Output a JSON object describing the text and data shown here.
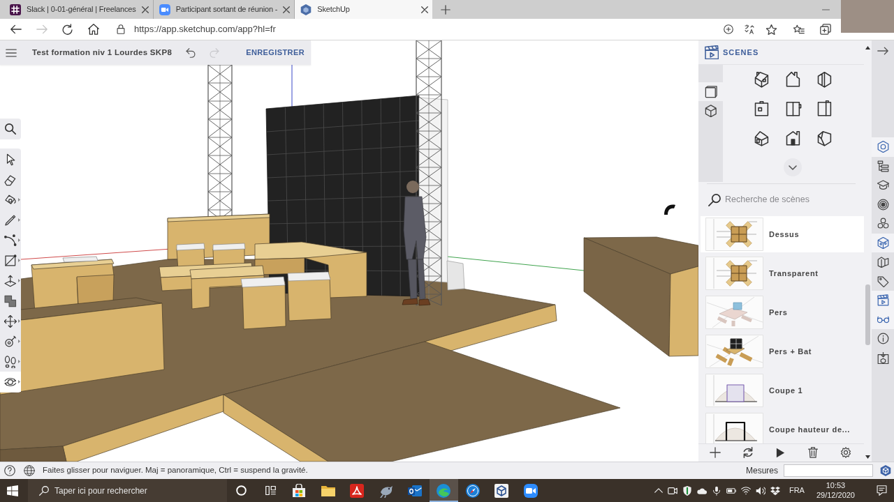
{
  "browser": {
    "tabs": [
      {
        "title": "Slack | 0-01-général | Freelances",
        "selected": false
      },
      {
        "title": "Participant sortant de réunion -",
        "selected": false
      },
      {
        "title": "SketchUp",
        "selected": true
      }
    ],
    "url": "https://app.sketchup.com/app?hl=fr",
    "forward_disabled": true
  },
  "app_header": {
    "title": "Test formation niv 1 Lourdes SKP8",
    "undo_disabled": false,
    "redo_disabled": true,
    "save_label": "ENREGISTRER"
  },
  "tools": [
    {
      "selected": false,
      "submenu": false
    },
    {
      "selected": false,
      "submenu": false
    },
    {
      "selected": false,
      "submenu": true
    },
    {
      "selected": false,
      "submenu": true
    },
    {
      "selected": false,
      "submenu": true
    },
    {
      "selected": false,
      "submenu": true
    },
    {
      "selected": false,
      "submenu": true
    },
    {
      "selected": false,
      "submenu": false
    },
    {
      "selected": false,
      "submenu": true
    },
    {
      "selected": false,
      "submenu": true
    },
    {
      "selected": false,
      "submenu": true
    },
    {
      "selected": true,
      "submenu": true
    }
  ],
  "scenes_panel": {
    "title": "SCENES",
    "view_tabs": [
      {
        "selected": true
      },
      {
        "selected": false
      }
    ],
    "search_placeholder": "Recherche de scènes",
    "scenes": [
      {
        "name": "Dessus",
        "selected": true
      },
      {
        "name": "Transparent",
        "selected": false
      },
      {
        "name": "Pers",
        "selected": false
      },
      {
        "name": "Pers + Bat",
        "selected": false
      },
      {
        "name": "Coupe 1",
        "selected": false
      },
      {
        "name": "Coupe hauteur de...",
        "selected": false
      }
    ]
  },
  "sidebar": [
    {
      "open": true
    },
    {
      "open": false
    },
    {
      "open": false
    },
    {
      "open": false
    },
    {
      "open": false
    },
    {
      "open": true
    },
    {
      "open": false
    },
    {
      "open": false
    },
    {
      "open": true
    },
    {
      "open": true
    },
    {
      "open": false
    },
    {
      "open": false
    }
  ],
  "status_bar": {
    "message": "Faites glisser pour naviguer. Maj = panoramique, Ctrl = suspend la gravité.",
    "measure_label": "Mesures"
  },
  "taskbar": {
    "search_placeholder": "Taper ici pour rechercher",
    "apps": [
      {
        "selected": false
      },
      {
        "selected": false
      },
      {
        "selected": false
      },
      {
        "selected": false
      },
      {
        "selected": false
      },
      {
        "selected": true
      },
      {
        "selected": false
      },
      {
        "selected": false
      },
      {
        "selected": false
      }
    ],
    "language": "FRA",
    "time": "10:53",
    "date": "29/12/2020"
  }
}
